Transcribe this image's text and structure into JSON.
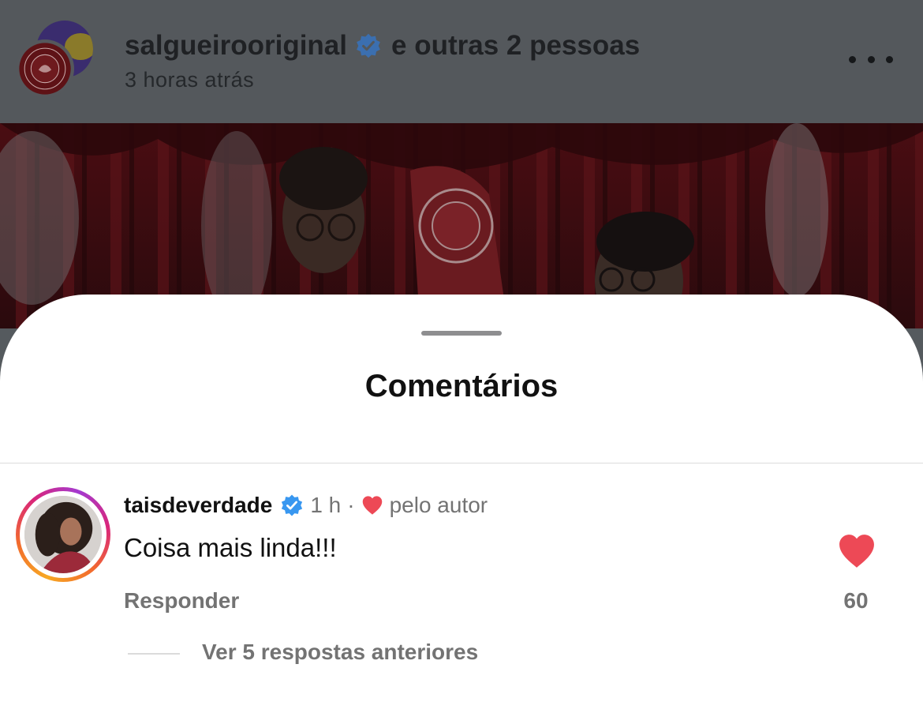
{
  "header": {
    "username": "salgueirooriginal",
    "others_text": "e outras 2 pessoas",
    "time": "3 horas atrás",
    "more_icon": "more-horizontal-icon"
  },
  "sheet": {
    "title": "Comentários"
  },
  "comment": {
    "username": "taisdeverdade",
    "time": "1 h",
    "separator": "·",
    "liked_by_author_text": "pelo autor",
    "text": "Coisa mais linda!!!",
    "like_count": "60",
    "reply_label": "Responder",
    "view_replies_label": "Ver 5 respostas anteriores"
  },
  "colors": {
    "verified_blue": "#3897f0",
    "like_red": "#ed4956",
    "muted_text": "#737373"
  }
}
